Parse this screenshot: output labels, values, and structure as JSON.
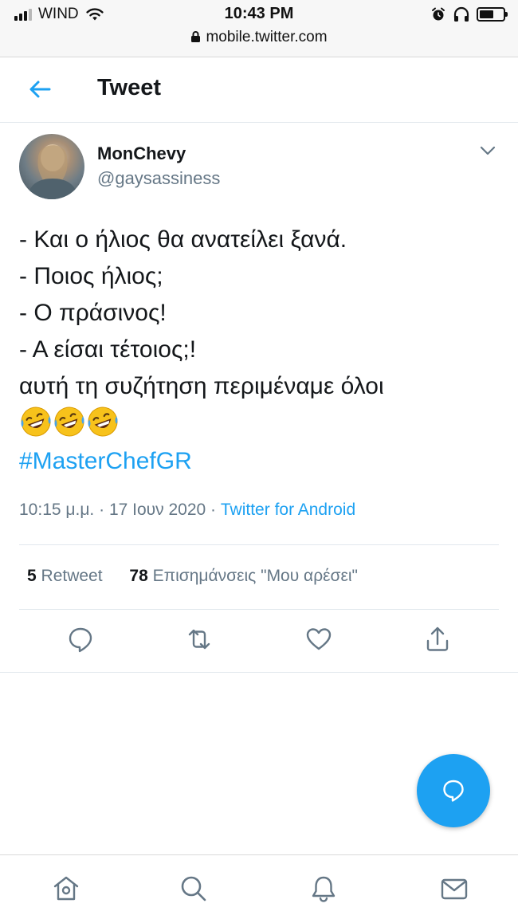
{
  "status_bar": {
    "carrier": "WIND",
    "time": "10:43 PM",
    "url": "mobile.twitter.com"
  },
  "header": {
    "title": "Tweet",
    "back_icon": "back-arrow-icon"
  },
  "tweet": {
    "display_name": "MonChevy",
    "handle": "@gaysassiness",
    "lines": [
      "- Και ο ήλιος θα ανατείλει ξανά.",
      "- Ποιος ήλιος;",
      "- Ο πράσινος!",
      "- Α είσαι τέτοιος;!",
      "αυτή τη συζήτηση περιμέναμε όλοι"
    ],
    "emoji_count": 3,
    "emoji_icon": "rolling-on-floor-laughing-emoji",
    "hashtag": "#MasterChefGR",
    "time": "10:15 μ.μ.",
    "date": "17 Ιουν 2020",
    "source": "Twitter for Android",
    "separator": "·",
    "retweets_count": "5",
    "retweets_label": "Retweet",
    "likes_count": "78",
    "likes_label": "Επισημάνσεις \"Μου αρέσει\""
  },
  "actions": [
    "reply-icon",
    "retweet-icon",
    "like-icon",
    "share-icon"
  ],
  "bottom_nav": [
    "home-icon",
    "search-icon",
    "notifications-icon",
    "messages-icon"
  ],
  "colors": {
    "accent": "#1da1f2",
    "text": "#14171a",
    "secondary": "#657786",
    "border": "#e1e8ed"
  }
}
